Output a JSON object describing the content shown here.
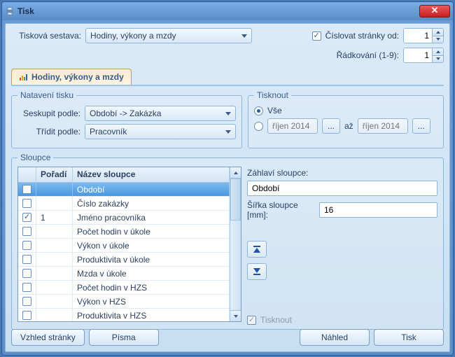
{
  "window": {
    "title": "Tisk"
  },
  "top": {
    "report_label": "Tisková sestava:",
    "report_value": "Hodiny, výkony a mzdy",
    "number_pages_label": "Číslovat stránky od:",
    "number_pages_value": "1",
    "line_spacing_label": "Řádkování (1-9):",
    "line_spacing_value": "1"
  },
  "tab": {
    "label": "Hodiny, výkony a mzdy"
  },
  "settings": {
    "legend": "Natavení tisku",
    "group_by_label": "Seskupit podle:",
    "group_by_value": "Období -> Zakázka",
    "sort_by_label": "Třídit podle:",
    "sort_by_value": "Pracovník"
  },
  "print_range": {
    "legend": "Tisknout",
    "all_label": "Vše",
    "range_from": "říjen 2014",
    "range_conj": "až",
    "range_to": "říjen 2014"
  },
  "columns": {
    "legend": "Sloupce",
    "th_order": "Pořadí",
    "th_name": "Název sloupce",
    "rows": [
      {
        "checked": false,
        "order": "",
        "name": "Období",
        "selected": true
      },
      {
        "checked": false,
        "order": "",
        "name": "Číslo zakázky"
      },
      {
        "checked": true,
        "order": "1",
        "name": "Jméno pracovníka"
      },
      {
        "checked": false,
        "order": "",
        "name": "Počet hodin v úkole"
      },
      {
        "checked": false,
        "order": "",
        "name": "Výkon v úkole"
      },
      {
        "checked": false,
        "order": "",
        "name": "Produktivita v úkole"
      },
      {
        "checked": false,
        "order": "",
        "name": "Mzda v úkole"
      },
      {
        "checked": false,
        "order": "",
        "name": "Počet hodin v HZS"
      },
      {
        "checked": false,
        "order": "",
        "name": "Výkon v HZS"
      },
      {
        "checked": false,
        "order": "",
        "name": "Produktivita v HZS"
      }
    ]
  },
  "right": {
    "header_label": "Záhlaví sloupce:",
    "header_value": "Období",
    "width_label": "Šířka sloupce [mm]:",
    "width_value": "16",
    "print_chk_label": "Tisknout"
  },
  "footer": {
    "page_layout": "Vzhled stránky",
    "fonts": "Písma",
    "preview": "Náhled",
    "print": "Tisk"
  }
}
